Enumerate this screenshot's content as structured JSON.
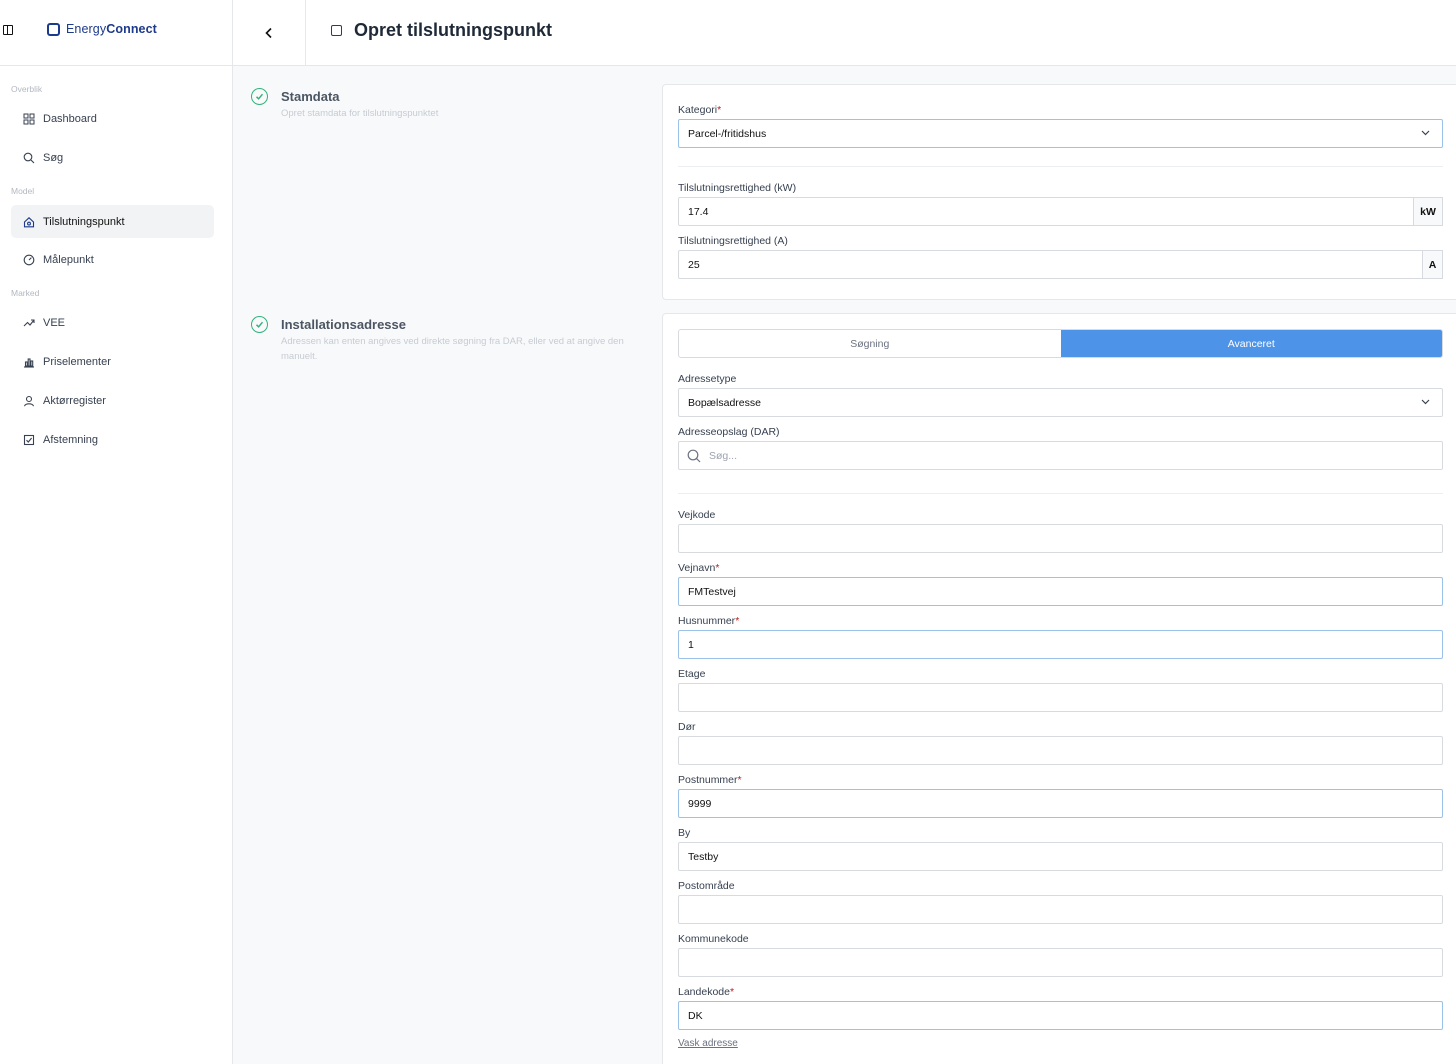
{
  "app": {
    "brand_prefix": "Energy",
    "brand_suffix": "Connect"
  },
  "page": {
    "title": "Opret tilslutningspunkt"
  },
  "sidebar": {
    "sections": [
      "Overblik",
      "Model",
      "Marked"
    ],
    "items": [
      {
        "label": "Dashboard",
        "icon": "grid-icon"
      },
      {
        "label": "Søg",
        "icon": "search-icon"
      },
      {
        "label": "Tilslutningspunkt",
        "icon": "house-icon",
        "active": true
      },
      {
        "label": "Målepunkt",
        "icon": "gauge-icon"
      },
      {
        "label": "VEE",
        "icon": "trend-icon"
      },
      {
        "label": "Priselementer",
        "icon": "bar-chart-icon"
      },
      {
        "label": "Aktørregister",
        "icon": "user-icon"
      },
      {
        "label": "Afstemning",
        "icon": "check-square-icon"
      }
    ]
  },
  "stamdata": {
    "title": "Stamdata",
    "desc": "Opret stamdata for tilslutningspunktet",
    "kategori_label": "Kategori",
    "kategori_value": "Parcel-/fritidshus",
    "kw_label": "Tilslutningsrettighed (kW)",
    "kw_value": "17.4",
    "kw_unit": "kW",
    "a_label": "Tilslutningsrettighed (A)",
    "a_value": "25",
    "a_unit": "A"
  },
  "address": {
    "title": "Installationsadresse",
    "desc": "Adressen kan enten angives ved direkte søgning fra DAR, eller ved at angive den manuelt.",
    "tab_search": "Søgning",
    "tab_advanced": "Avanceret",
    "adressetype_label": "Adressetype",
    "adressetype_value": "Bopælsadresse",
    "dar_label": "Adresseopslag (DAR)",
    "dar_placeholder": "Søg...",
    "fields": {
      "vejkode": {
        "label": "Vejkode",
        "value": ""
      },
      "vejnavn": {
        "label": "Vejnavn",
        "value": "FMTestvej"
      },
      "husnummer": {
        "label": "Husnummer",
        "value": "1"
      },
      "etage": {
        "label": "Etage",
        "value": ""
      },
      "dor": {
        "label": "Dør",
        "value": ""
      },
      "postnummer": {
        "label": "Postnummer",
        "value": "9999"
      },
      "by": {
        "label": "By",
        "value": "Testby"
      },
      "postomrade": {
        "label": "Postområde",
        "value": ""
      },
      "kommunekode": {
        "label": "Kommunekode",
        "value": ""
      },
      "landekode": {
        "label": "Landekode",
        "value": "DK"
      }
    },
    "wash_link": "Vask adresse"
  },
  "colors": {
    "accent": "#4d94e8",
    "brand": "#1e3a8a",
    "success": "#34b27b",
    "required": "#b91c1c"
  }
}
